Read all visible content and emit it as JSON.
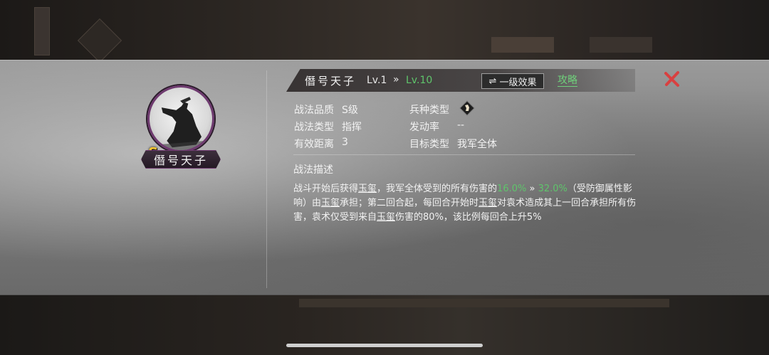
{
  "skill": {
    "grade_badge": "S",
    "portrait_name": "僭号天子",
    "title": "僭号天子",
    "level_current": "Lv.1",
    "level_arrow": "»",
    "level_max": "Lv.10",
    "effect_button": "一级效果",
    "effect_icon": "⇌",
    "guide_link": "攻略"
  },
  "attributes": {
    "quality_label": "战法品质",
    "quality_value": "S级",
    "type_label": "战法类型",
    "type_value": "指挥",
    "range_label": "有效距离",
    "range_value": "3",
    "unit_label": "兵种类型",
    "unit_icon": "horse-hoof-icon",
    "trigger_label": "发动率",
    "trigger_value": "--",
    "target_label": "目标类型",
    "target_value": "我军全体"
  },
  "description": {
    "title": "战法描述",
    "p1": "战斗开始后获得",
    "k1": "玉玺",
    "p2": "，我军全体受到的所有伤害的",
    "v1": "16.0%",
    "arrow": " » ",
    "v2": "32.0%",
    "p3": "（受防御属性影响）由",
    "k2": "玉玺",
    "p4": "承担；第二回合起，每回合开始时",
    "k3": "玉玺",
    "p5": "对袁术造成其上一回合承担所有伤害，袁术仅受到来自",
    "k4": "玉玺",
    "p6": "伤害的80%，该比例每回合上升5%"
  },
  "colors": {
    "green": "#5fc46b",
    "close": "#d94040",
    "portrait_ring": "#6e3a6f",
    "grade": "#f1c232"
  }
}
